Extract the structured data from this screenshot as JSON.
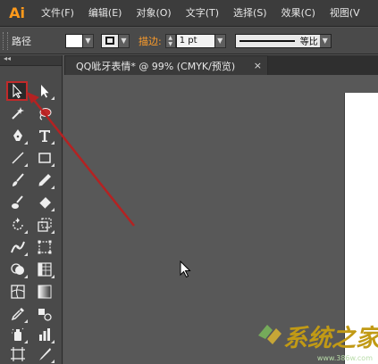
{
  "app": {
    "logo": "Ai",
    "menu": [
      "文件(F)",
      "编辑(E)",
      "对象(O)",
      "文字(T)",
      "选择(S)",
      "效果(C)",
      "视图(V"
    ]
  },
  "control_bar": {
    "selection_label": "路径",
    "fill_color": "#ffffff",
    "stroke_label": "描边:",
    "stroke_weight": "1 pt",
    "profile_label": "等比"
  },
  "document": {
    "tab_title": "QQ呲牙表情* @ 99% (CMYK/预览)",
    "close_symbol": "×"
  },
  "tools_panel": {
    "collapse_symbol": "◂◂",
    "selected_tool": "selection-tool"
  },
  "watermark": {
    "text": "系统之家",
    "url": "www.386w.com"
  },
  "colors": {
    "annotation": "#b42222",
    "logo": "#ff9a1b",
    "stroke_label": "#ff9d2a"
  }
}
